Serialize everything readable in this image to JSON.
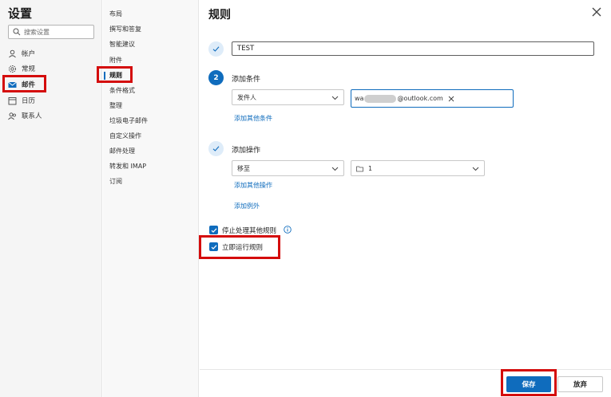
{
  "nav": {
    "title": "设置",
    "search_placeholder": "搜索设置",
    "items": [
      {
        "label": "帐户",
        "icon": "person-icon"
      },
      {
        "label": "常规",
        "icon": "gear-icon"
      },
      {
        "label": "邮件",
        "icon": "mail-icon",
        "active": true
      },
      {
        "label": "日历",
        "icon": "calendar-icon"
      },
      {
        "label": "联系人",
        "icon": "contacts-icon"
      }
    ]
  },
  "submenu": {
    "items": [
      {
        "label": "布局"
      },
      {
        "label": "撰写和答复"
      },
      {
        "label": "智能建议"
      },
      {
        "label": "附件"
      },
      {
        "label": "规则",
        "active": true
      },
      {
        "label": "条件格式"
      },
      {
        "label": "整理"
      },
      {
        "label": "垃圾电子邮件"
      },
      {
        "label": "自定义操作"
      },
      {
        "label": "邮件处理"
      },
      {
        "label": "转发和 IMAP"
      },
      {
        "label": "订阅"
      }
    ]
  },
  "panel": {
    "title": "规则",
    "rule_name": "TEST",
    "step2_number": "2",
    "condition_label": "添加条件",
    "condition_dropdown": "发件人",
    "email_prefix": "wa",
    "email_suffix": "@outlook.com",
    "add_condition_link": "添加其他条件",
    "action_label": "添加操作",
    "action_dropdown": "移至",
    "folder_dropdown": "1",
    "add_action_link": "添加其他操作",
    "add_exception_link": "添加例外",
    "stop_processing_label": "停止处理其他规则",
    "run_now_label": "立即运行规则",
    "save_label": "保存",
    "discard_label": "放弃"
  },
  "colors": {
    "accent": "#0f6cbd",
    "highlight": "#d40c0c",
    "step_done_bg": "#deecf9"
  }
}
